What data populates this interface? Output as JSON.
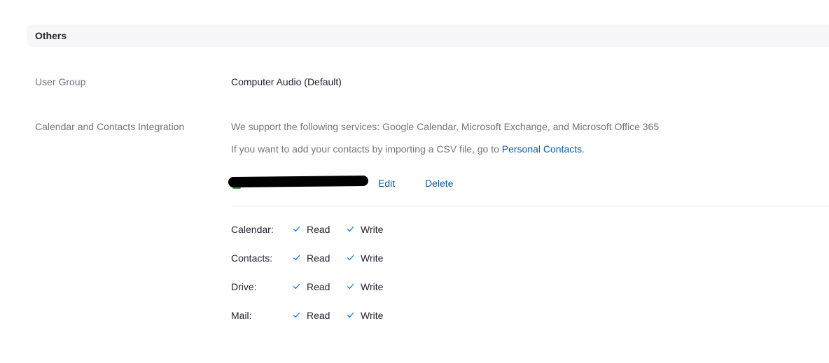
{
  "section": {
    "title": "Others"
  },
  "user_group": {
    "label": "User Group",
    "value": "Computer Audio (Default)"
  },
  "calendar_integration": {
    "label": "Calendar and Contacts Integration",
    "support_text": "We support the following services: Google Calendar, Microsoft Exchange, and Microsoft Office 365",
    "csv_text_prefix": "If you want to add your contacts by importing a CSV file, go to ",
    "csv_link": "Personal Contacts",
    "csv_text_suffix": ".",
    "account": {
      "edit_label": "Edit",
      "delete_label": "Delete"
    },
    "permissions": [
      {
        "name": "Calendar:",
        "read": "Read",
        "write": "Write"
      },
      {
        "name": "Contacts:",
        "read": "Read",
        "write": "Write"
      },
      {
        "name": "Drive:",
        "read": "Read",
        "write": "Write"
      },
      {
        "name": "Mail:",
        "read": "Read",
        "write": "Write"
      }
    ]
  },
  "colors": {
    "link": "#0e5a9c",
    "check": "#0e72ed",
    "label": "#6e7680"
  },
  "icons": {
    "check": "check-icon",
    "provider": "google-logo-icon"
  }
}
